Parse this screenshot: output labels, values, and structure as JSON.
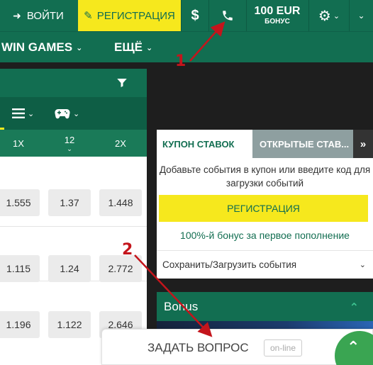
{
  "header": {
    "login_label": "ВОЙТИ",
    "register_label": "РЕГИСТРАЦИЯ",
    "currency_symbol": "$",
    "bonus_amount": "100 EUR",
    "bonus_caption": "БОНУС"
  },
  "nav": {
    "win_games": "WIN GAMES",
    "more": "ЕЩЁ"
  },
  "odds": {
    "columns": [
      "1X",
      "12",
      "2X"
    ],
    "rows": [
      [
        "1.555",
        "1.37",
        "1.448"
      ],
      [
        "1.115",
        "1.24",
        "2.772"
      ],
      [
        "1.196",
        "1.122",
        "2.646"
      ]
    ]
  },
  "coupon": {
    "tab_active": "КУПОН СТАВОК",
    "tab_open": "ОТКРЫТЫЕ СТАВ...",
    "tab_more": "»",
    "empty_text": "Добавьте события в купон или введите код для загрузки событий",
    "register_button": "РЕГИСТРАЦИЯ",
    "bonus_text": "100%-й бонус за первое пополнение",
    "save_load": "Сохранить/Загрузить события"
  },
  "bonus_block": {
    "title": "Bonus"
  },
  "ask": {
    "label": "ЗАДАТЬ ВОПРОС",
    "status": "on-line"
  },
  "annotations": {
    "label_1": "1",
    "label_2": "2",
    "color": "#c4151c"
  },
  "colors": {
    "brand_green": "#126e51",
    "accent_yellow": "#f6e81d"
  }
}
